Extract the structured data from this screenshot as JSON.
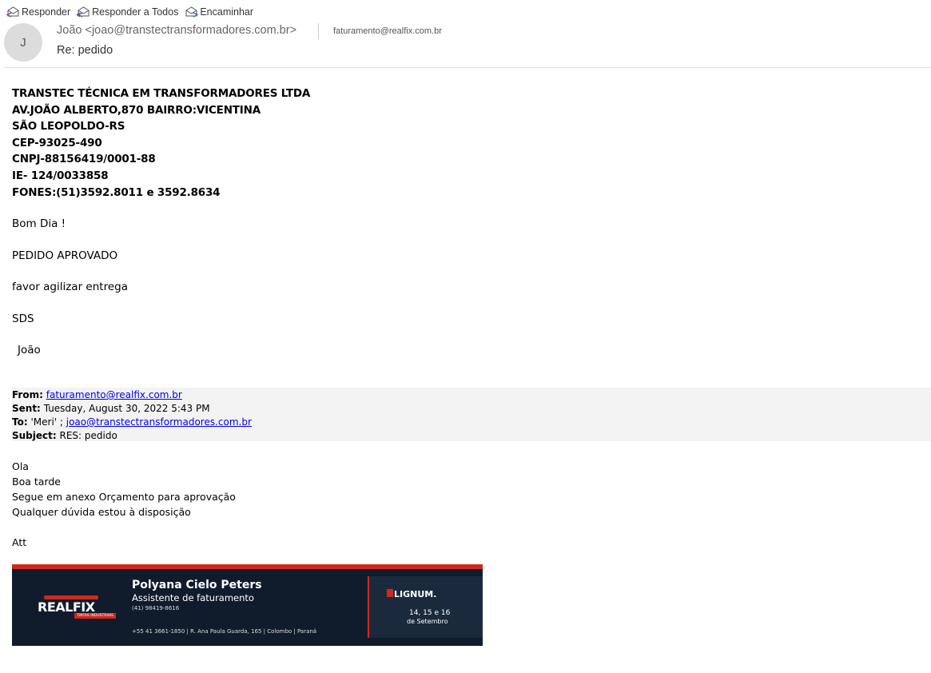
{
  "toolbar": {
    "reply_label": "Responder",
    "reply_all_label": "Responder a Todos",
    "forward_label": "Encaminhar"
  },
  "header": {
    "avatar_initial": "J",
    "sender": "João <joao@transtectransformadores.com.br>",
    "recipient": "faturamento@realfix.com.br",
    "subject": "Re: pedido"
  },
  "company_lines": [
    "TRANSTEC TÉCNICA EM TRANSFORMADORES LTDA",
    "AV.JOÃO ALBERTO,870 BAIRRO:VICENTINA",
    "SÃO LEOPOLDO-RS",
    "CEP-93025-490",
    "CNPJ-88156419/0001-88",
    "IE- 124/0033858",
    "FONES:(51)3592.8011 e 3592.8634"
  ],
  "reply_body": {
    "greeting": "Bom Dia !",
    "approved": "PEDIDO APROVADO",
    "request": "favor agilizar entrega",
    "closing": "SDS",
    "signature": "João"
  },
  "quoted_header": {
    "from_label": "From:",
    "from_value": "faturamento@realfix.com.br",
    "sent_label": "Sent:",
    "sent_value": "Tuesday, August 30, 2022 5:43 PM",
    "to_label": "To:",
    "to_prefix": "'Meri' ; ",
    "to_link": "joao@transtectransformadores.com.br",
    "subject_label": "Subject:",
    "subject_value": "RES: pedido"
  },
  "quoted_body": {
    "line1": "Ola",
    "line2": "Boa tarde",
    "line3": "Segue em anexo Orçamento para aprovação",
    "line4": "Qualquer dúvida estou à disposição",
    "closing": "Att"
  },
  "signature_banner": {
    "logo_text": "REALFIX",
    "logo_tagline": "TINTAS INDUSTRIAIS",
    "name": "Polyana Cielo Peters",
    "role": "Assistente de faturamento",
    "phone": "(41) 98419-8616",
    "address": "+55 41 3661-1850  |  R. Ana Paula Guarda, 165  |  Colombo  |  Paraná",
    "event_logo": "LIGNUM.",
    "event_dates": "14, 15 e 16",
    "event_month": "de Setembro"
  }
}
